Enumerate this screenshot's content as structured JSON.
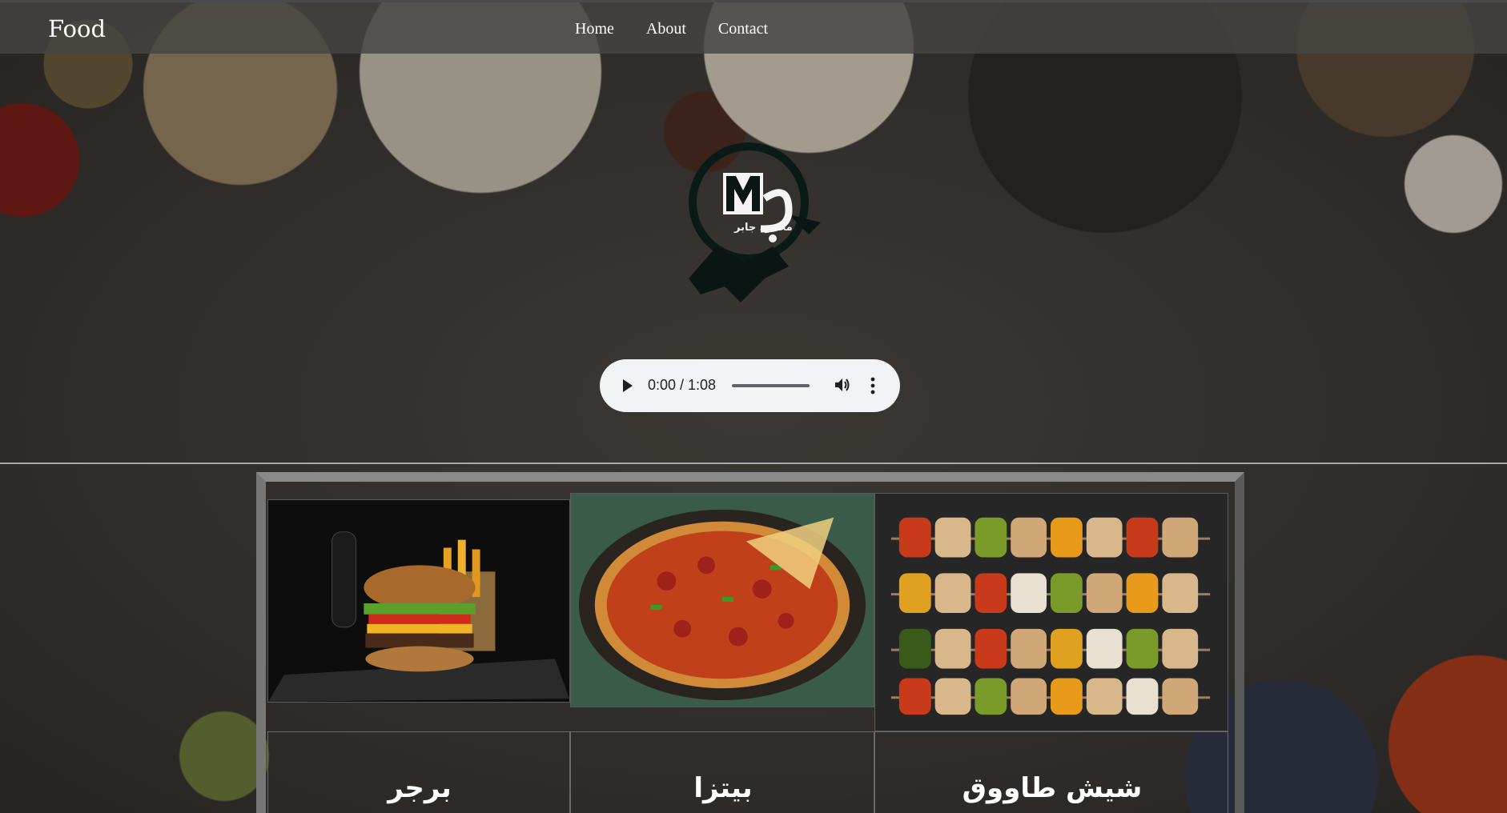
{
  "navbar": {
    "brand": "Food",
    "links": [
      "Home",
      "About",
      "Contact"
    ]
  },
  "logo": {
    "icon": "logo-emblem",
    "mark": "M ج",
    "caption": "محمود جابر"
  },
  "audio": {
    "current_time": "0:00",
    "duration": "1:08",
    "time_text": "0:00 / 1:08",
    "progress": 0
  },
  "menu": {
    "items": [
      {
        "name": "برجر",
        "icon": "burger-image"
      },
      {
        "name": "بيتزا",
        "icon": "pizza-image"
      },
      {
        "name": "شيش طاووق",
        "icon": "shish-tawook-image"
      }
    ]
  }
}
